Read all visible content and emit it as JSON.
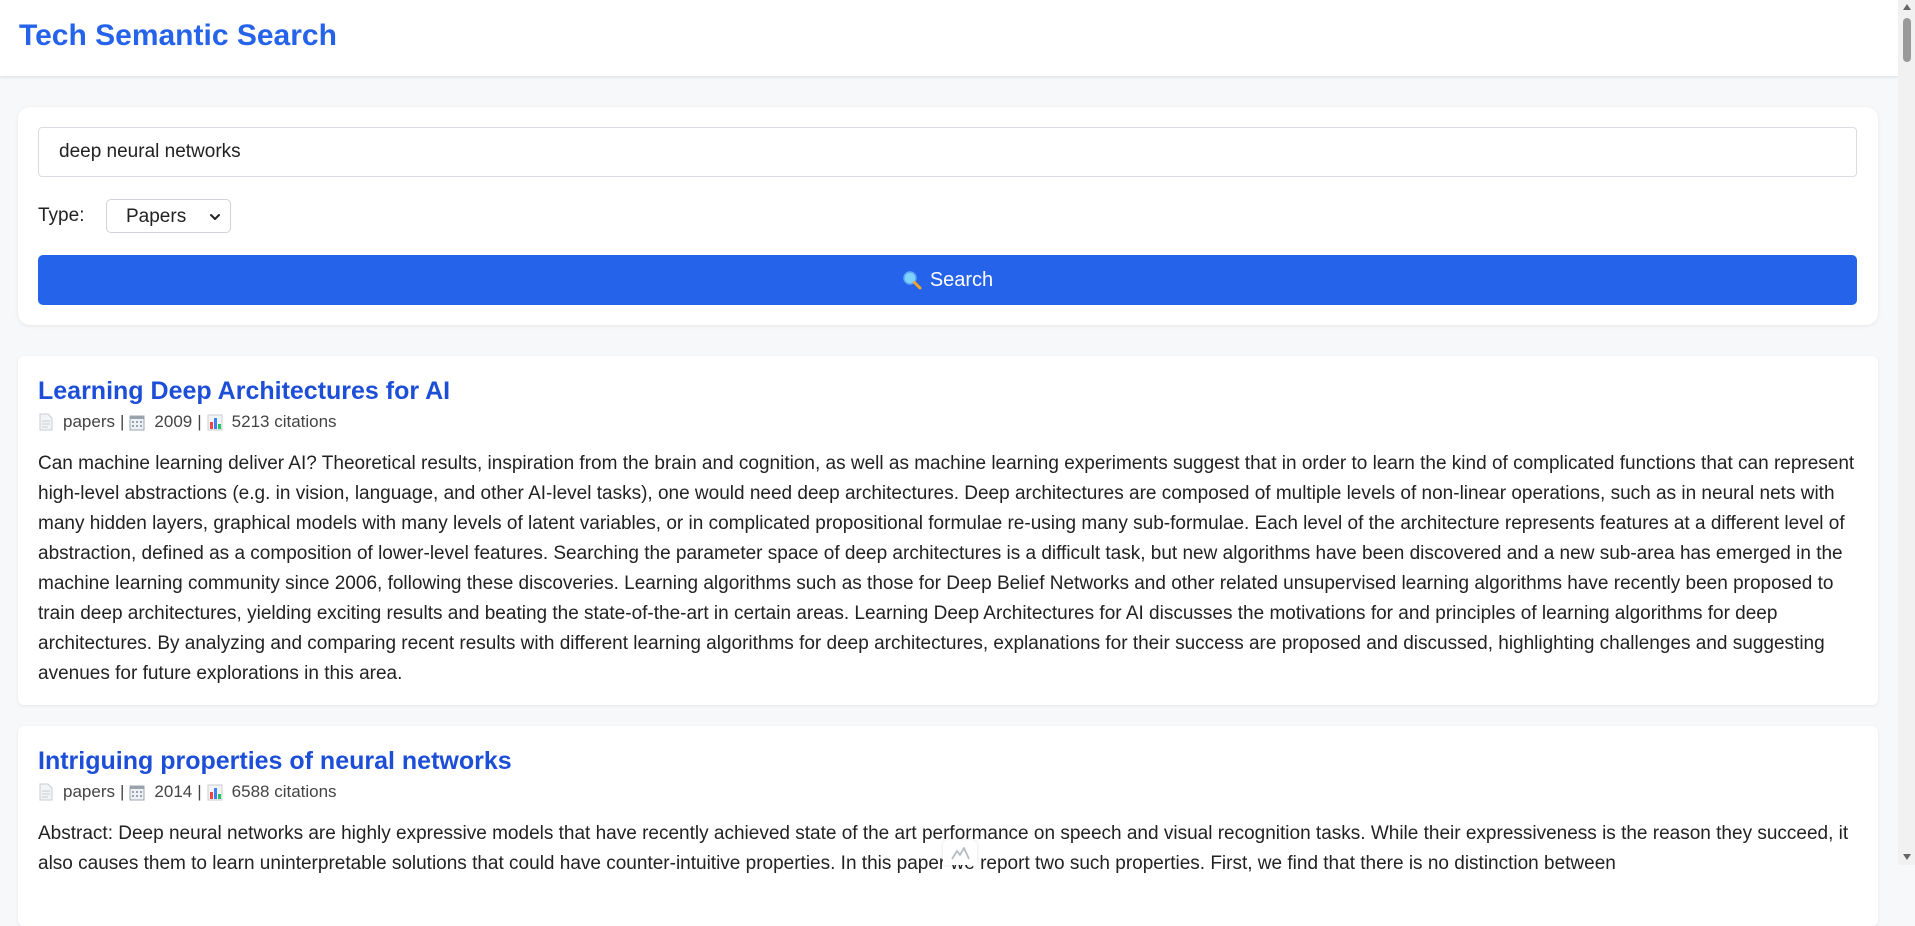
{
  "app": {
    "title": "Tech Semantic Search"
  },
  "search": {
    "query": "deep neural networks",
    "type_label": "Type:",
    "type_selected": "Papers",
    "button_label": "Search"
  },
  "results": [
    {
      "title": "Learning Deep Architectures for AI",
      "category": "papers",
      "year": "2009",
      "citations": "5213 citations",
      "abstract": "Can machine learning deliver AI? Theoretical results, inspiration from the brain and cognition, as well as machine learning experiments suggest that in order to learn the kind of complicated functions that can represent high-level abstractions (e.g. in vision, language, and other AI-level tasks), one would need deep architectures. Deep architectures are composed of multiple levels of non-linear operations, such as in neural nets with many hidden layers, graphical models with many levels of latent variables, or in complicated propositional formulae re-using many sub-formulae. Each level of the architecture represents features at a different level of abstraction, defined as a composition of lower-level features. Searching the parameter space of deep architectures is a difficult task, but new algorithms have been discovered and a new sub-area has emerged in the machine learning community since 2006, following these discoveries. Learning algorithms such as those for Deep Belief Networks and other related unsupervised learning algorithms have recently been proposed to train deep architectures, yielding exciting results and beating the state-of-the-art in certain areas. Learning Deep Architectures for AI discusses the motivations for and principles of learning algorithms for deep architectures. By analyzing and comparing recent results with different learning algorithms for deep architectures, explanations for their success are proposed and discussed, highlighting challenges and suggesting avenues for future explorations in this area."
    },
    {
      "title": "Intriguing properties of neural networks",
      "category": "papers",
      "year": "2014",
      "citations": "6588 citations",
      "abstract": "Abstract: Deep neural networks are highly expressive models that have recently achieved state of the art performance on speech and visual recognition tasks. While their expressiveness is the reason they succeed, it also causes them to learn uninterpretable solutions that could have counter-intuitive properties. In this paper we report two such properties. First, we find that there is no distinction between"
    }
  ],
  "colors": {
    "accent": "#2563eb",
    "title_link": "#1d4ed8",
    "page_bg": "#f7f8fa"
  },
  "icons": {
    "search_button": "magnifier-icon",
    "category": "document-icon",
    "year": "calendar-icon",
    "citations": "bar-chart-icon",
    "select": "chevron-down-icon"
  }
}
